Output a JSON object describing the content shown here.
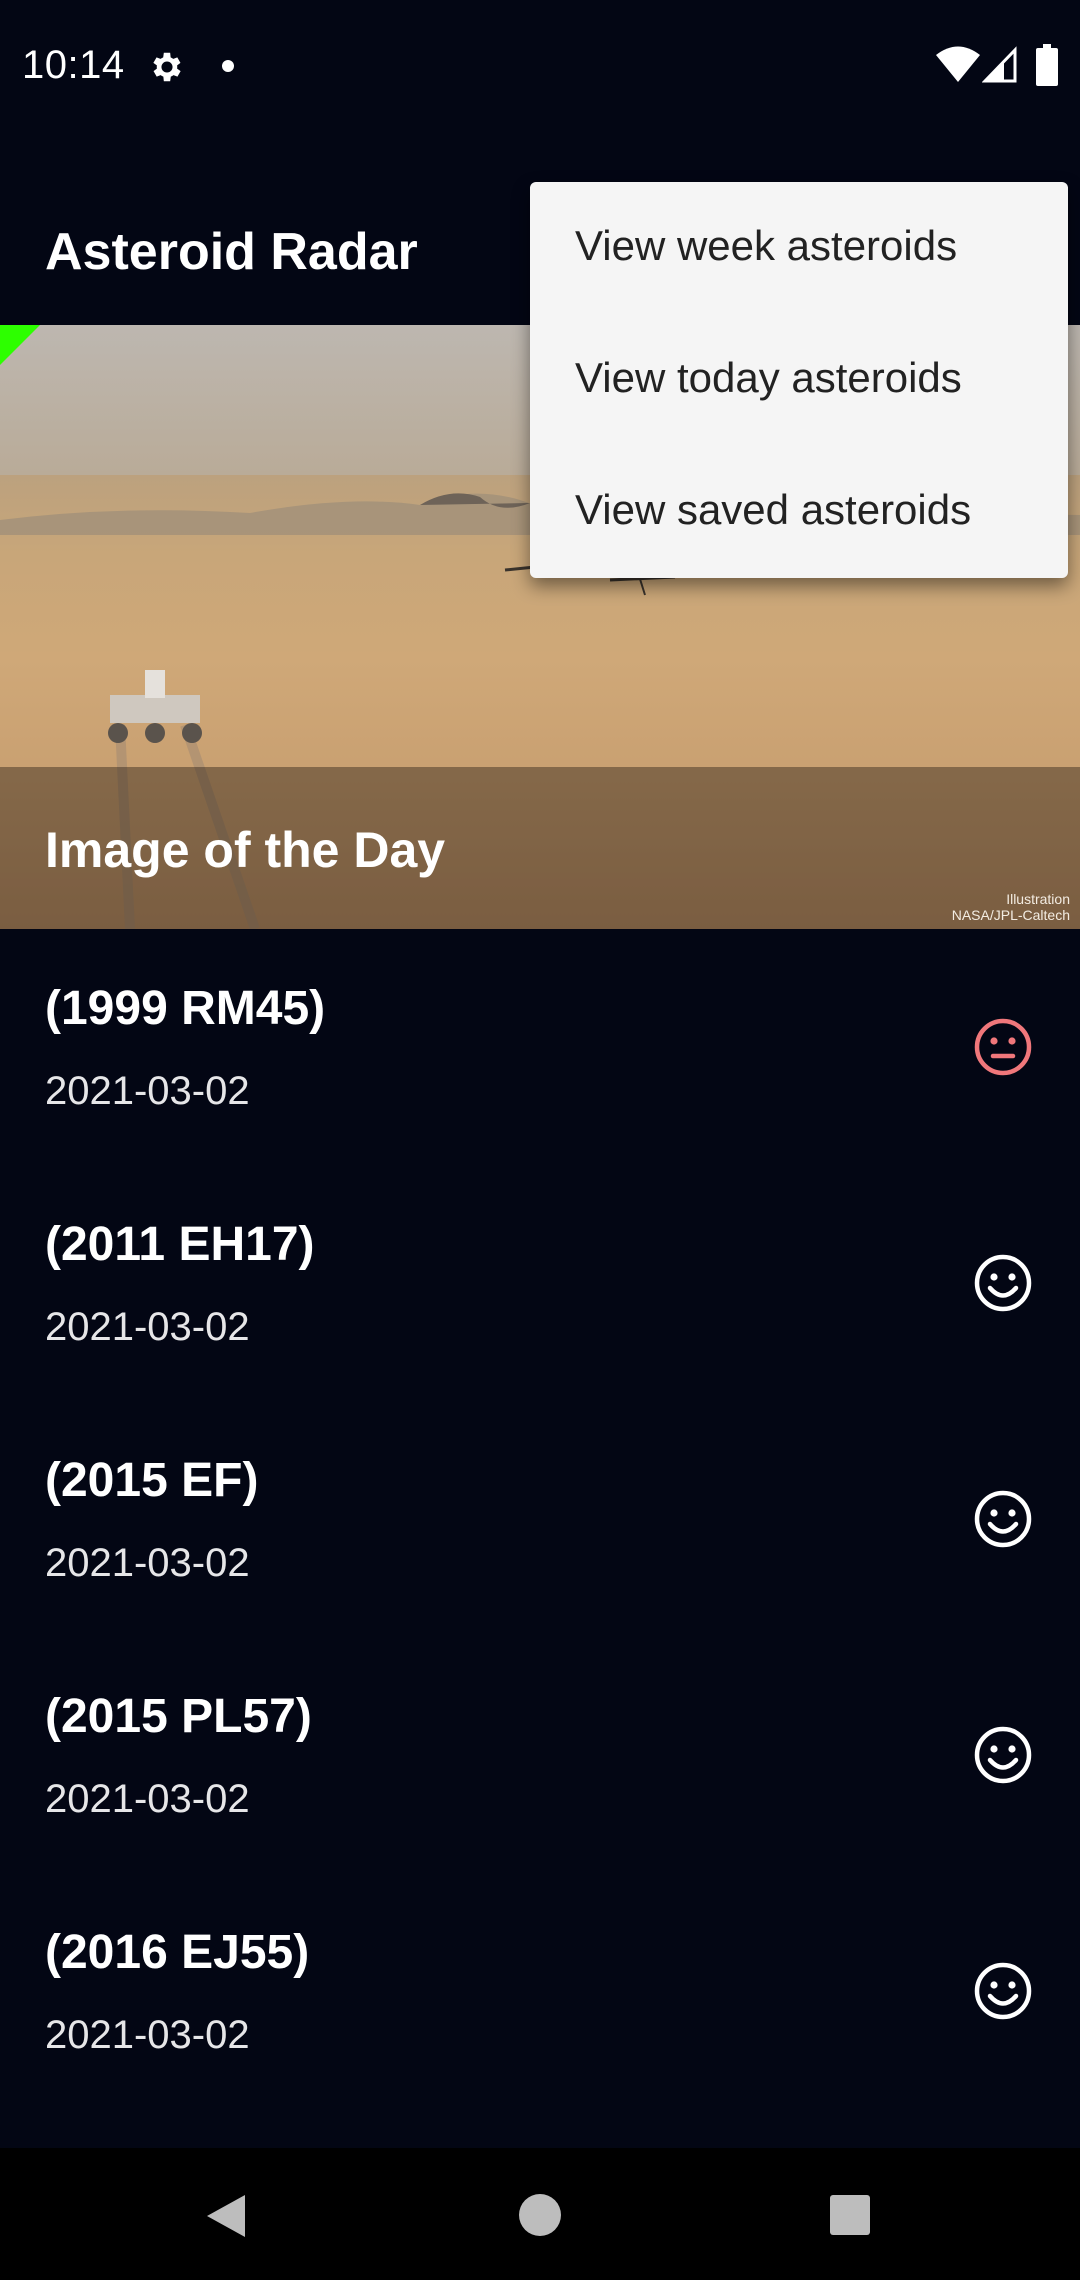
{
  "status_bar": {
    "time": "10:14"
  },
  "app_bar": {
    "title": "Asteroid Radar"
  },
  "image_of_the_day": {
    "caption": "Image of the Day",
    "credit_line1": "Illustration",
    "credit_line2": "NASA/JPL-Caltech"
  },
  "asteroids": [
    {
      "name": "(1999 RM45)",
      "date": "2021-03-02",
      "status": "hazardous",
      "icon_color": "#f0777b"
    },
    {
      "name": "(2011 EH17)",
      "date": "2021-03-02",
      "status": "safe",
      "icon_color": "#ffffff"
    },
    {
      "name": "(2015 EF)",
      "date": "2021-03-02",
      "status": "safe",
      "icon_color": "#ffffff"
    },
    {
      "name": "(2015 PL57)",
      "date": "2021-03-02",
      "status": "safe",
      "icon_color": "#ffffff"
    },
    {
      "name": "(2016 EJ55)",
      "date": "2021-03-02",
      "status": "safe",
      "icon_color": "#ffffff"
    }
  ],
  "overflow_menu": {
    "items": [
      {
        "label": "View week asteroids"
      },
      {
        "label": "View today asteroids"
      },
      {
        "label": "View saved asteroids"
      }
    ]
  },
  "colors": {
    "background": "#030614",
    "hazardous": "#f0777b",
    "safe": "#ffffff",
    "menu_background": "#f5f5f5"
  }
}
